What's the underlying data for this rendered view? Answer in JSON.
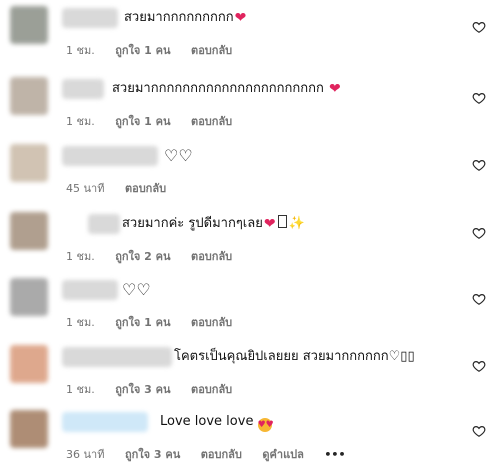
{
  "comments": [
    {
      "text": "สวยมากกกกกกกกก",
      "emoji": "heart",
      "time": "1 ชม.",
      "likes": "ถูกใจ 1 คน",
      "reply": "ตอบกลับ"
    },
    {
      "text": "สวยมากกกกกกกกกกกกกกกกกกกกกก",
      "emoji": "heart",
      "time": "1 ชม.",
      "likes": "ถูกใจ 1 คน",
      "reply": "ตอบกลับ"
    },
    {
      "text": "♡♡",
      "time": "45 นาที",
      "reply": "ตอบกลับ"
    },
    {
      "text": "สวยมากค่ะ รูปดีมากๆเลย",
      "emoji": "heart-box-sparkle",
      "time": "1 ชม.",
      "likes": "ถูกใจ 2 คน",
      "reply": "ตอบกลับ"
    },
    {
      "text": "♡♡",
      "time": "1 ชม.",
      "likes": "ถูกใจ 1 คน",
      "reply": "ตอบกลับ"
    },
    {
      "text": "โคตรเป็นคุณยิปเลยยย สวยมากกกกกก♡▯▯",
      "time": "1 ชม.",
      "likes": "ถูกใจ 3 คน",
      "reply": "ตอบกลับ"
    },
    {
      "text": "Love love love",
      "emoji": "heart-eyes",
      "time": "36 นาที",
      "likes": "ถูกใจ 3 คน",
      "reply": "ตอบกลับ",
      "translate": "ดูคำแปล",
      "more": "•••"
    }
  ]
}
